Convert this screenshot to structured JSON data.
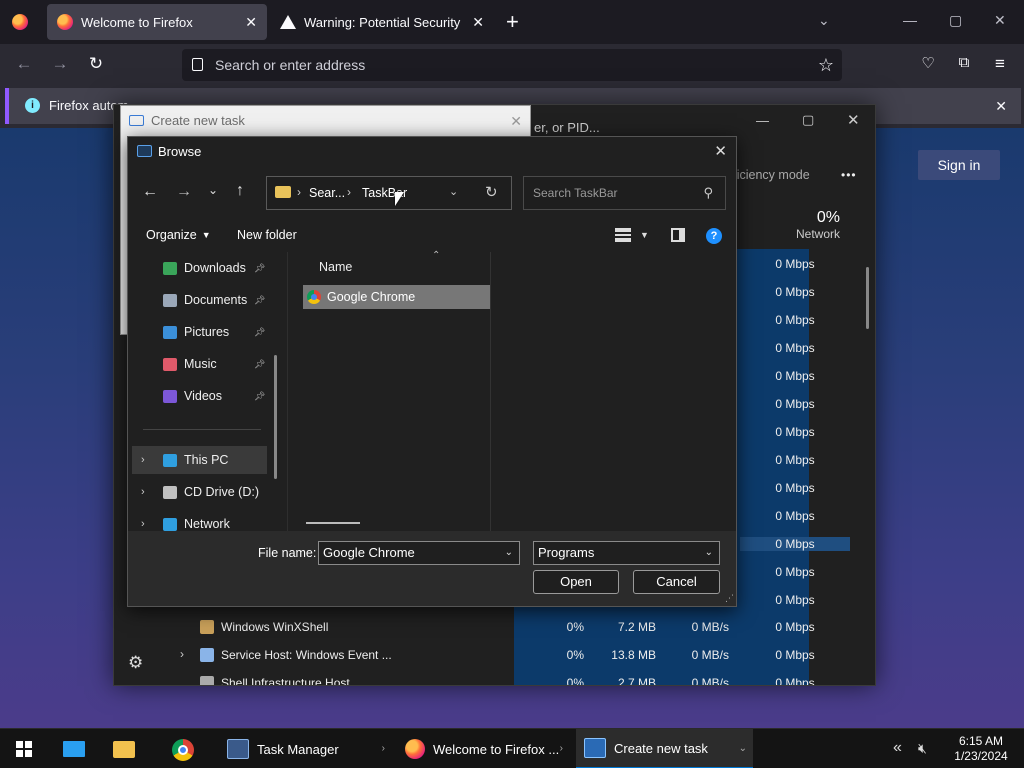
{
  "firefox": {
    "tabs": [
      {
        "title": "Welcome to Firefox",
        "active": true
      },
      {
        "title": "Warning: Potential Security Risk",
        "active": false
      }
    ],
    "new_tab": "+",
    "url_placeholder": "Search or enter address",
    "notification": "Firefox autom",
    "sign_in": "Sign in"
  },
  "task_manager": {
    "search_fragment": "er, or PID...",
    "efficiency_mode": "fficiency mode",
    "more": "•••",
    "network_percent": "0%",
    "network_label": "Network",
    "net_values": [
      "0 Mbps",
      "0 Mbps",
      "0 Mbps",
      "0 Mbps",
      "0 Mbps",
      "0 Mbps",
      "0 Mbps",
      "0 Mbps",
      "0 Mbps",
      "0 Mbps",
      "0 Mbps",
      "0 Mbps",
      "0 Mbps"
    ],
    "processes": [
      {
        "name": "Windows WinXShell",
        "cpu": "0%",
        "memory": "7.2 MB",
        "disk": "0 MB/s",
        "network": "0 Mbps",
        "expandable": false
      },
      {
        "name": "Service Host: Windows Event ...",
        "cpu": "0%",
        "memory": "13.8 MB",
        "disk": "0 MB/s",
        "network": "0 Mbps",
        "expandable": true
      },
      {
        "name": "Shell Infrastructure Host",
        "cpu": "0%",
        "memory": "2.7 MB",
        "disk": "0 MB/s",
        "network": "0 Mbps",
        "expandable": false
      }
    ]
  },
  "create_task": {
    "title": "Create new task"
  },
  "browse": {
    "title": "Browse",
    "breadcrumb": [
      "Sear...",
      "TaskBar"
    ],
    "search_placeholder": "Search TaskBar",
    "organize": "Organize",
    "new_folder": "New folder",
    "help": "?",
    "nav_quick": [
      {
        "label": "Downloads",
        "icon": "downloads-icon",
        "color": "#3aa55a"
      },
      {
        "label": "Documents",
        "icon": "documents-icon",
        "color": "#9aa7b8"
      },
      {
        "label": "Pictures",
        "icon": "pictures-icon",
        "color": "#3b8fd9"
      },
      {
        "label": "Music",
        "icon": "music-icon",
        "color": "#e05a6a"
      },
      {
        "label": "Videos",
        "icon": "videos-icon",
        "color": "#7c57d8"
      }
    ],
    "nav_tree": [
      {
        "label": "This PC",
        "icon": "computer-icon",
        "color": "#2f9fe0"
      },
      {
        "label": "CD Drive (D:)",
        "icon": "cd-drive-icon",
        "color": "#c0c0c0"
      },
      {
        "label": "Network",
        "icon": "network-icon",
        "color": "#2f9fe0"
      }
    ],
    "column_name": "Name",
    "files": [
      {
        "name": "Google Chrome",
        "icon": "chrome-icon"
      }
    ],
    "file_name_label": "File name:",
    "file_name_value": "Google Chrome",
    "file_type": "Programs",
    "open": "Open",
    "cancel": "Cancel"
  },
  "taskbar": {
    "apps": [
      {
        "label": "Task Manager"
      },
      {
        "label": "Welcome to Firefox ..."
      },
      {
        "label": "Create new task",
        "active": true
      }
    ],
    "time": "6:15 AM",
    "date": "1/23/2024"
  },
  "colors": {
    "firefox_bg": "#1c1b22",
    "accent_blue": "#0078d4",
    "selection": "#777777"
  }
}
